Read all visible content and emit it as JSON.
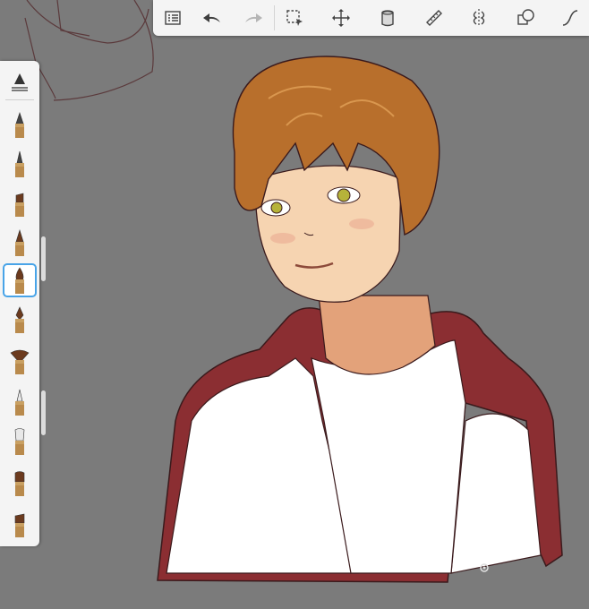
{
  "app": {
    "accent_color": "#49a4e8",
    "toolbar_color": "#f4f4f4",
    "canvas_background": "#7b7b7b"
  },
  "toolbar": {
    "tools": [
      {
        "name": "layers-list",
        "icon": "list-icon"
      },
      {
        "name": "undo",
        "icon": "undo-arrow-icon"
      },
      {
        "name": "redo",
        "icon": "redo-arrow-icon"
      },
      {
        "name": "selection",
        "icon": "marquee-select-icon"
      },
      {
        "name": "transform",
        "icon": "move-arrows-icon"
      },
      {
        "name": "fill",
        "icon": "paint-bucket-icon"
      },
      {
        "name": "ruler",
        "icon": "ruler-icon"
      },
      {
        "name": "symmetry",
        "icon": "symmetry-icon"
      },
      {
        "name": "shapes",
        "icon": "shapes-icon"
      },
      {
        "name": "stroke",
        "icon": "curve-icon"
      }
    ]
  },
  "brush_palette": {
    "selected_index": 4,
    "brushes": [
      "pencil-icon",
      "pencil-fine-icon",
      "marker-icon",
      "pen-icon",
      "paintbrush-icon",
      "ink-nib-icon",
      "fan-brush-icon",
      "airbrush-icon",
      "soft-brush-icon",
      "flat-brush-icon",
      "chisel-brush-icon"
    ]
  }
}
